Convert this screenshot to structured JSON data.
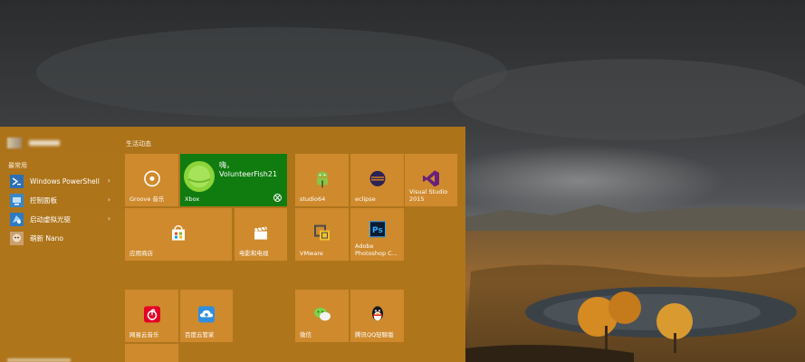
{
  "start_menu": {
    "accent_color": "#b2761a",
    "live_tiles_heading": "生活动态",
    "most_used_heading": "最常用",
    "apps": [
      {
        "label": "Windows PowerShell",
        "icon": "powershell-icon",
        "has_submenu": true
      },
      {
        "label": "控制面板",
        "icon": "control-panel-icon",
        "has_submenu": true
      },
      {
        "label": "启动虚拟光驱",
        "icon": "virtual-drive-icon",
        "has_submenu": true
      },
      {
        "label": "萌新 Nano",
        "icon": "nano-icon",
        "has_submenu": false
      }
    ],
    "tiles": {
      "groove": "Groove 音乐",
      "xbox": {
        "greeting_line1": "嗨，",
        "greeting_line2": "VolunteerFish21",
        "label": "Xbox"
      },
      "studio64": "studio64",
      "eclipse": "eclipse",
      "visual_studio": "Visual Studio 2015",
      "store": "应用商店",
      "movies": "电影和电视",
      "vmware": "VMware",
      "photoshop": "Adobe Photoshop C...",
      "netease_music": "网易云音乐",
      "baidu_cloud": "百度云管家",
      "wechat": "微信",
      "qq": "腾讯QQ轻聊版"
    }
  }
}
